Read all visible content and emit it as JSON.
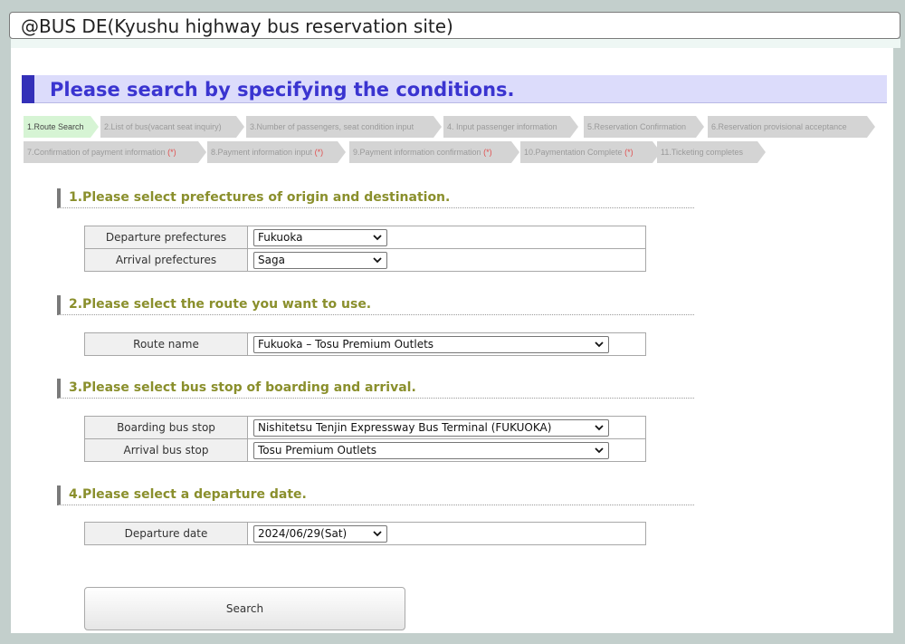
{
  "window": {
    "title": "@BUS DE(Kyushu highway bus reservation site)"
  },
  "heading": "Please search by specifying the conditions.",
  "steps_row1": [
    {
      "label": "1.Route Search",
      "active": true
    },
    {
      "label": "2.List of bus(vacant seat inquiry)"
    },
    {
      "label": "3.Number of passengers, seat condition input"
    },
    {
      "label": "4. Input passenger information"
    },
    {
      "label": "5.Reservation Confirmation"
    },
    {
      "label": "6.Reservation provisional acceptance"
    }
  ],
  "steps_row2": [
    {
      "label": "7.Confirmation of payment information",
      "mark": "(*)"
    },
    {
      "label": "8.Payment information input",
      "mark": "(*)"
    },
    {
      "label": "9.Payment information confirmation",
      "mark": "(*)"
    },
    {
      "label": "10.Paymentation Complete",
      "mark": "(*)"
    },
    {
      "label": "11.Ticketing completes"
    }
  ],
  "sections": {
    "s1": "1.Please select prefectures of origin and destination.",
    "s2": "2.Please select the route you want to use.",
    "s3": "3.Please select bus stop of boarding and arrival.",
    "s4": "4.Please select a departure date."
  },
  "fields": {
    "departure_pref_label": "Departure prefectures",
    "departure_pref_value": "Fukuoka",
    "arrival_pref_label": "Arrival prefectures",
    "arrival_pref_value": "Saga",
    "route_label": "Route name",
    "route_value": "Fukuoka – Tosu Premium Outlets",
    "boarding_label": "Boarding bus stop",
    "boarding_value": "Nishitetsu Tenjin Expressway Bus Terminal (FUKUOKA)",
    "arrival_stop_label": "Arrival bus stop",
    "arrival_stop_value": "Tosu Premium Outlets",
    "date_label": "Departure date",
    "date_value": "2024/06/29(Sat)"
  },
  "search_button": "Search",
  "icons": {
    "select_arrow": "chevron-down-icon"
  }
}
